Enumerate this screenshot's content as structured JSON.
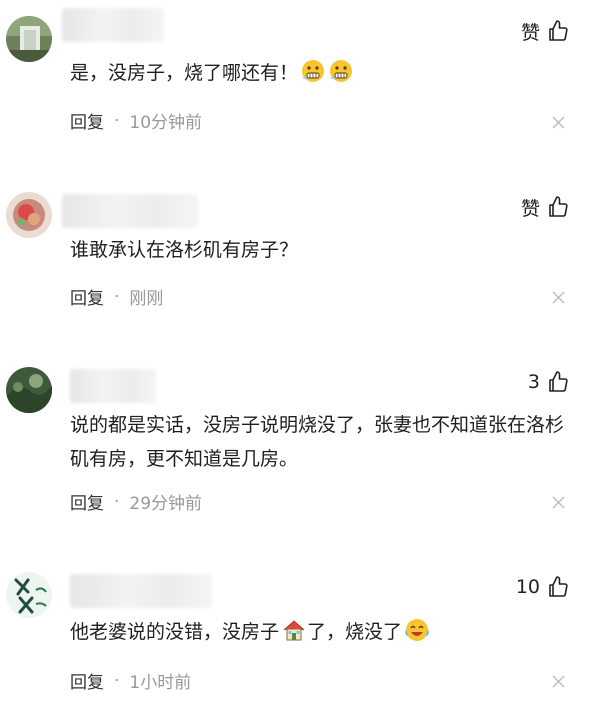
{
  "comments": [
    {
      "text": "是，没房子，烧了哪还有！",
      "like_label": "赞",
      "reply_label": "回复",
      "separator": "·",
      "time": "10分钟前",
      "emoji_icons": [
        "grimace-face-icon",
        "grimace-face-icon"
      ]
    },
    {
      "text": "谁敢承认在洛杉矶有房子？",
      "like_label": "赞",
      "reply_label": "回复",
      "separator": "·",
      "time": "刚刚"
    },
    {
      "text": "说的都是实话，没房子说明烧没了，张妻也不知道张在洛杉矶有房，更不知道是几房。",
      "like_label": "3",
      "reply_label": "回复",
      "separator": "·",
      "time": "29分钟前"
    },
    {
      "text_part1": "他老婆说的没错，没房子",
      "text_part2": "了，烧没了",
      "like_label": "10",
      "reply_label": "回复",
      "separator": "·",
      "time": "1小时前",
      "emoji_icons": [
        "house-icon",
        "laughing-crying-face-icon"
      ]
    }
  ],
  "colors": {
    "text": "#1f1f1f",
    "meta_gray": "#999999",
    "background": "#ffffff"
  }
}
